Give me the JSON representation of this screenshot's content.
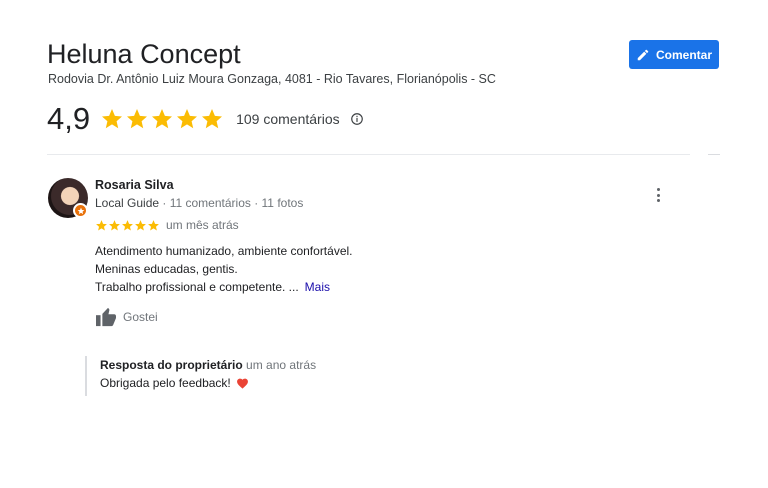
{
  "place": {
    "title": "Heluna Concept",
    "address": "Rodovia Dr. Antônio Luiz Moura Gonzaga, 4081 - Rio Tavares, Florianópolis - SC"
  },
  "comment_button": {
    "label": "Comentar",
    "icon": "pencil-icon"
  },
  "rating": {
    "value": "4,9",
    "stars": 5,
    "count_label": "109 comentários",
    "info_icon": "info-icon"
  },
  "review": {
    "author": "Rosaria Silva",
    "badge": "Local Guide",
    "meta": " · 11 comentários · 11 fotos",
    "stars": 5,
    "date": "um mês atrás",
    "lines": [
      "Atendimento humanizado, ambiente confortável.",
      "Meninas educadas, gentis.",
      "Trabalho profissional e competente. ..."
    ],
    "more_label": "Mais",
    "like_label": "Gostei"
  },
  "owner_response": {
    "title": "Resposta do proprietário",
    "date": "um ano atrás",
    "text": "Obrigada pelo feedback!",
    "emoji_icon": "heart-icon"
  },
  "colors": {
    "accent": "#1a73e8",
    "star": "#fbbc04",
    "link": "#1a0dab",
    "heart": "#ea4335",
    "guide_badge": "#e8710a"
  }
}
